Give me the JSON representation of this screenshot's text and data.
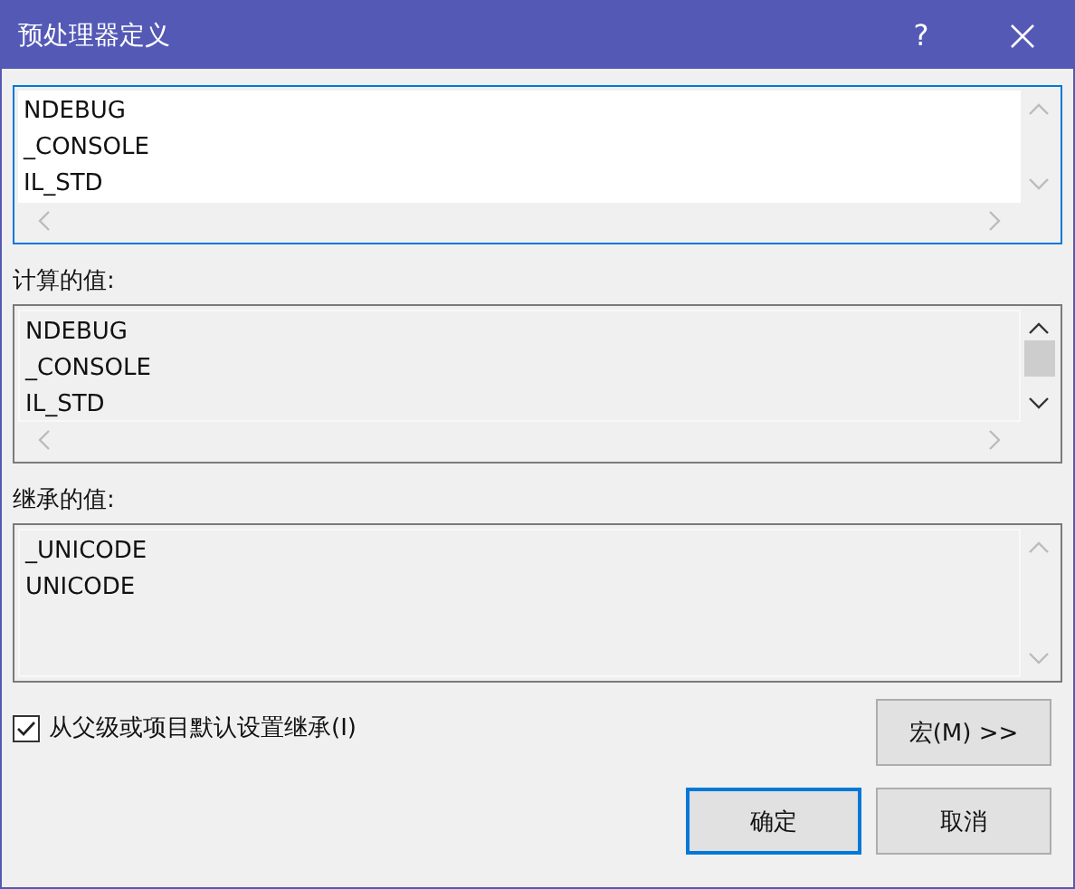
{
  "window": {
    "title": "预处理器定义",
    "help": "?"
  },
  "lists": [
    {
      "kind": "editable",
      "focused": true,
      "lines": [
        "NDEBUG",
        "_CONSOLE",
        "IL_STD"
      ],
      "hscroll": true,
      "thumb": false
    },
    {
      "kind": "readonly",
      "label": "计算的值:",
      "focused": false,
      "lines": [
        "NDEBUG",
        "_CONSOLE",
        "IL_STD"
      ],
      "hscroll": true,
      "thumb": true
    },
    {
      "kind": "readonly",
      "label": "继承的值:",
      "focused": false,
      "lines": [
        "_UNICODE",
        "UNICODE"
      ],
      "hscroll": false,
      "thumb": false
    }
  ],
  "inherit": {
    "label": "从父级或项目默认设置继承(I)",
    "checked": true
  },
  "macro_button": "宏(M) >>",
  "buttons": [
    {
      "label": "确定",
      "default": true
    },
    {
      "label": "取消",
      "default": false
    }
  ]
}
